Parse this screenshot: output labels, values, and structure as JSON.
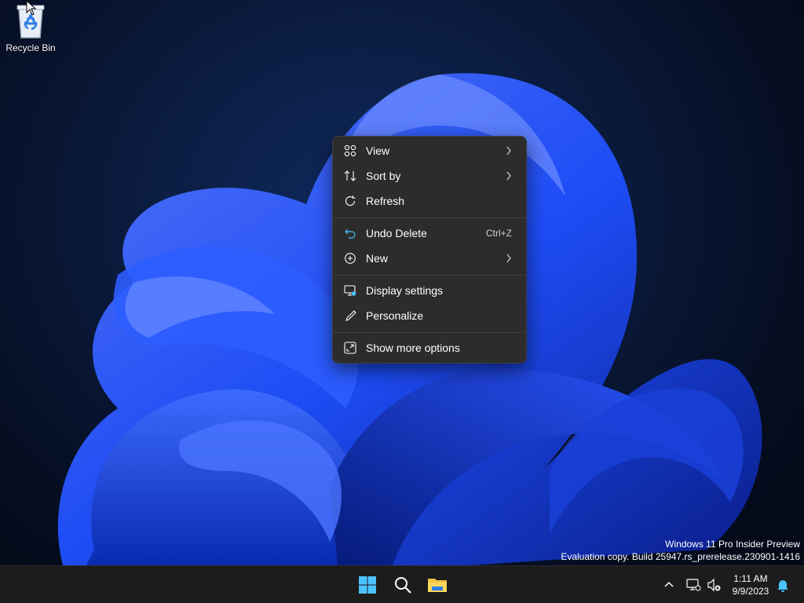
{
  "desktop": {
    "recycle_bin_label": "Recycle Bin"
  },
  "context_menu": {
    "items": [
      {
        "label": "View",
        "icon": "grid-icon",
        "has_submenu": true
      },
      {
        "label": "Sort by",
        "icon": "sort-icon",
        "has_submenu": true
      },
      {
        "label": "Refresh",
        "icon": "refresh-icon",
        "has_submenu": false
      },
      {
        "label": "Undo Delete",
        "icon": "undo-icon",
        "shortcut": "Ctrl+Z"
      },
      {
        "label": "New",
        "icon": "plus-circle-icon",
        "has_submenu": true
      },
      {
        "label": "Display settings",
        "icon": "display-settings-icon"
      },
      {
        "label": "Personalize",
        "icon": "brush-icon"
      },
      {
        "label": "Show more options",
        "icon": "expand-icon"
      }
    ]
  },
  "watermark": {
    "line1": "Windows 11 Pro Insider Preview",
    "line2": "Evaluation copy. Build 25947.rs_prerelease.230901-1416"
  },
  "taskbar": {
    "pinned": [
      "start-icon",
      "search-icon",
      "file-explorer-icon"
    ],
    "tray": [
      "chevron-up-icon",
      "network-icon",
      "volume-muted-icon",
      "notification-bell-icon"
    ],
    "time": "1:11 AM",
    "date": "9/9/2023"
  },
  "colors": {
    "accent": "#4cc2ff",
    "menu_bg": "#2c2c2c",
    "taskbar_bg": "#1c1c1c",
    "wallpaper_blue": "#1f4fff"
  }
}
